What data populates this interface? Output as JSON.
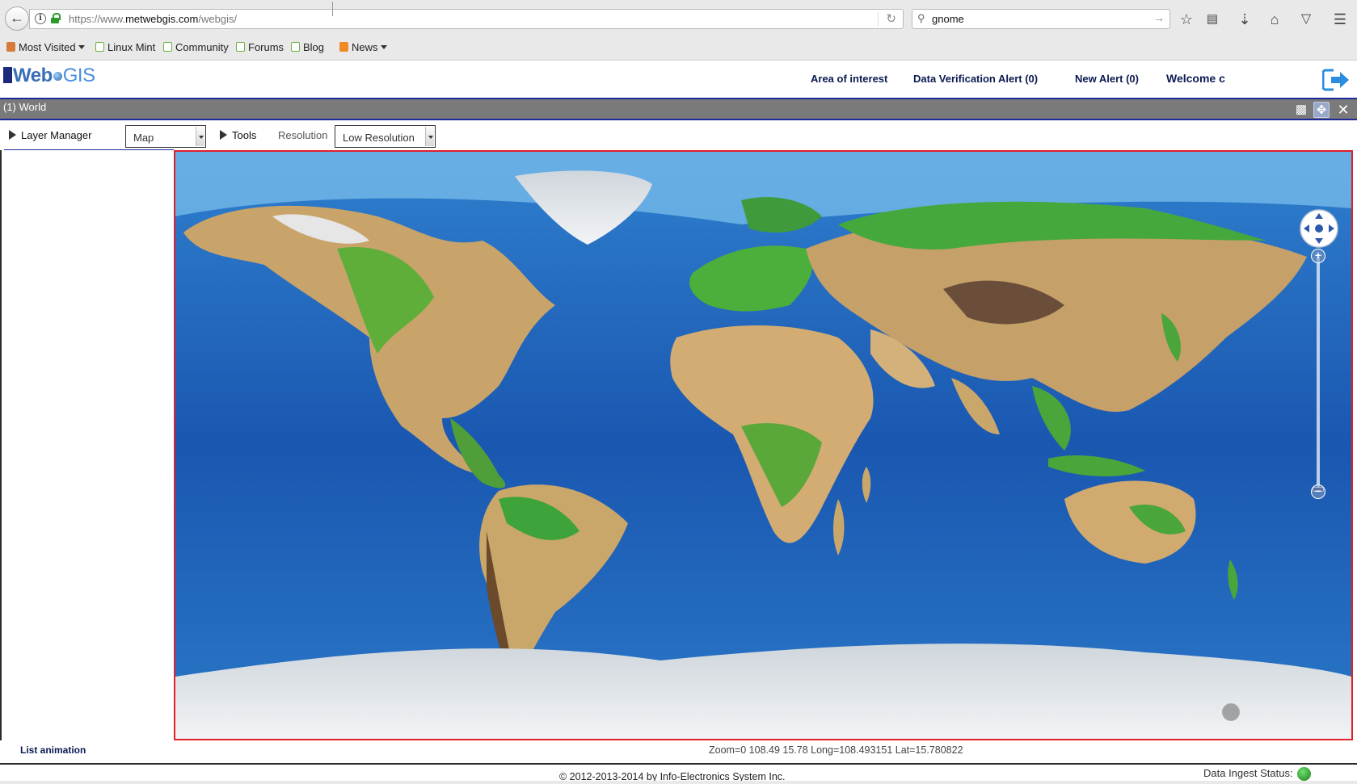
{
  "browser": {
    "url_prefix": "https://www.",
    "url_domain": "metwebgis.com",
    "url_path": "/webgis/",
    "search_value": "gnome",
    "bookmarks": [
      {
        "label": "Most Visited",
        "icon": "folder-icon",
        "dropdown": true
      },
      {
        "label": "Linux Mint",
        "icon": "mint-icon"
      },
      {
        "label": "Community",
        "icon": "mint-icon"
      },
      {
        "label": "Forums",
        "icon": "mint-icon"
      },
      {
        "label": "Blog",
        "icon": "mint-icon"
      },
      {
        "label": "News",
        "icon": "rss-icon",
        "dropdown": true
      }
    ]
  },
  "app": {
    "logo_part1": "Web",
    "logo_part2": "GIS",
    "nav": {
      "area_of_interest": "Area of interest",
      "data_verification_alert": "Data Verification Alert (0)",
      "new_alert": "New Alert (0)",
      "welcome": "Welcome c"
    }
  },
  "window": {
    "title": "(1) World"
  },
  "toolbar": {
    "layer_manager": "Layer Manager",
    "map_select": "Map",
    "tools": "Tools",
    "resolution_label": "Resolution",
    "resolution_select": "Low Resolution"
  },
  "map": {
    "zoom_in_label": "+",
    "zoom_out_label": "−"
  },
  "status": {
    "list_animation": "List animation",
    "coords": "Zoom=0 108.49 15.78 Long=108.493151 Lat=15.780822",
    "footer": "© 2012-2013-2014 by Info-Electronics System Inc.",
    "data_ingest": "Data Ingest Status:",
    "ingest_color": "#2aa52a"
  },
  "colors": {
    "accent": "#1c2a9a",
    "map_border": "#e0202a",
    "ocean": "#1e64b8"
  }
}
